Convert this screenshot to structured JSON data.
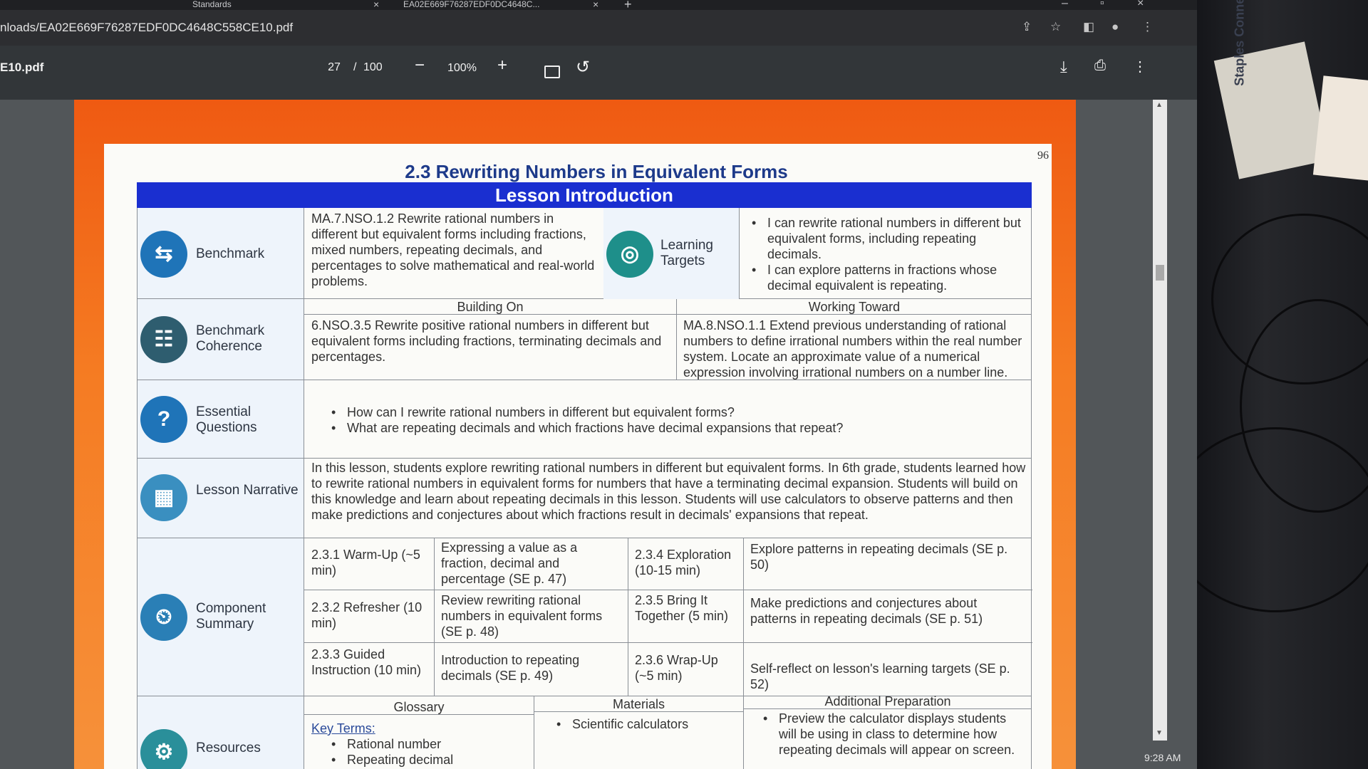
{
  "browser": {
    "tabs": [
      {
        "label": "Standards"
      },
      {
        "label": "EA02E669F76287EDF0DC4648C..."
      }
    ],
    "url": "nloads/EA02E669F76287EDF0DC4648C558CE10.pdf"
  },
  "pdf_toolbar": {
    "filename": "E10.pdf",
    "page_current": "27",
    "page_separator": "/",
    "page_total": "100",
    "zoom": "100%"
  },
  "document": {
    "page_number": "96",
    "title": "2.3 Rewriting Numbers in Equivalent Forms",
    "banner": "Lesson Introduction",
    "benchmark": {
      "label": "Benchmark",
      "text": "MA.7.NSO.1.2 Rewrite rational numbers in different but equivalent forms including fractions, mixed numbers, repeating decimals, and percentages to solve mathematical and real-world problems."
    },
    "learning_targets": {
      "label": "Learning Targets",
      "items": [
        "I can rewrite rational numbers in different but equivalent forms, including repeating decimals.",
        "I can explore patterns in fractions whose decimal equivalent is repeating."
      ]
    },
    "coherence": {
      "label": "Benchmark Coherence",
      "building_on_header": "Building On",
      "building_on_text": "6.NSO.3.5 Rewrite positive rational numbers in different but equivalent forms including fractions, terminating decimals and percentages.",
      "working_toward_header": "Working Toward",
      "working_toward_text": "MA.8.NSO.1.1 Extend previous understanding of rational numbers to define irrational numbers within the real number system. Locate an approximate value of a numerical expression involving irrational numbers on a number line."
    },
    "essential_questions": {
      "label": "Essential Questions",
      "items": [
        "How can I rewrite rational numbers in different but equivalent forms?",
        "What are repeating decimals and which fractions have decimal expansions that repeat?"
      ]
    },
    "lesson_narrative": {
      "label": "Lesson Narrative",
      "text": "In this lesson, students explore rewriting rational numbers in different but equivalent forms. In 6th grade, students learned how to rewrite rational numbers in equivalent forms for numbers that have a terminating decimal expansion. Students will build on this knowledge and learn about repeating decimals in this lesson. Students will use calculators to observe patterns and then make predictions and conjectures about which fractions result in decimals' expansions that repeat."
    },
    "component_summary": {
      "label": "Component Summary",
      "components": [
        {
          "name": "2.3.1 Warm-Up (~5 min)",
          "desc": "Expressing a value as a fraction, decimal and percentage (SE p. 47)"
        },
        {
          "name": "2.3.4 Exploration (10-15 min)",
          "desc": "Explore patterns in repeating decimals (SE p. 50)"
        },
        {
          "name": "2.3.2 Refresher (10 min)",
          "desc": "Review rewriting rational numbers in equivalent forms (SE p. 48)"
        },
        {
          "name": "2.3.5 Bring It Together (5 min)",
          "desc": "Make predictions and conjectures about patterns in repeating decimals (SE p. 51)"
        },
        {
          "name": "2.3.3 Guided Instruction (10 min)",
          "desc": "Introduction to repeating decimals (SE p. 49)"
        },
        {
          "name": "2.3.6 Wrap-Up (~5 min)",
          "desc": "Self-reflect on lesson's learning targets (SE p. 52)"
        }
      ]
    },
    "resources": {
      "label": "Resources",
      "glossary_header": "Glossary",
      "key_terms_label": "Key Terms:",
      "key_terms": [
        "Rational number",
        "Repeating decimal"
      ],
      "materials_header": "Materials",
      "materials": [
        "Scientific calculators"
      ],
      "prep_header": "Additional Preparation",
      "prep_items": [
        "Preview the calculator displays students will be using in class to determine how repeating decimals will appear on screen."
      ]
    }
  },
  "taskbar": {
    "clock": "9:28 AM"
  },
  "desk": {
    "box_label": "Staples Connect"
  }
}
